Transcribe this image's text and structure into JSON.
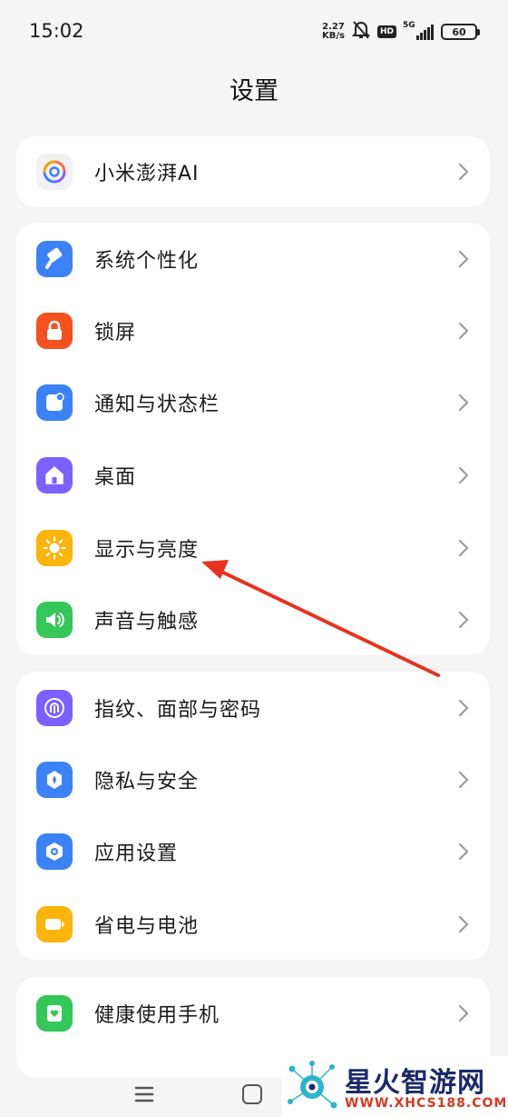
{
  "status_bar": {
    "time": "15:02",
    "net_speed_value": "2.27",
    "net_speed_unit": "KB/s",
    "hd": "HD",
    "network": "5G",
    "battery": "60"
  },
  "page": {
    "title": "设置"
  },
  "groups": [
    {
      "items": [
        {
          "label": "小米澎湃AI",
          "icon": "xiaomi-hyperai-icon"
        }
      ]
    },
    {
      "items": [
        {
          "label": "系统个性化",
          "icon": "brush-icon",
          "color": "#3b82f6"
        },
        {
          "label": "锁屏",
          "icon": "lock-icon",
          "color": "#f4511e"
        },
        {
          "label": "通知与状态栏",
          "icon": "notification-icon",
          "color": "#3b82f6"
        },
        {
          "label": "桌面",
          "icon": "home-icon",
          "color": "#7b61ff"
        },
        {
          "label": "显示与亮度",
          "icon": "sun-icon",
          "color": "#fbb40a"
        },
        {
          "label": "声音与触感",
          "icon": "speaker-icon",
          "color": "#34c759"
        }
      ]
    },
    {
      "items": [
        {
          "label": "指纹、面部与密码",
          "icon": "fingerprint-icon",
          "color": "#7b61ff"
        },
        {
          "label": "隐私与安全",
          "icon": "shield-icon",
          "color": "#3b82f6"
        },
        {
          "label": "应用设置",
          "icon": "app-settings-icon",
          "color": "#3b82f6"
        },
        {
          "label": "省电与电池",
          "icon": "battery-icon",
          "color": "#fbb40a"
        }
      ]
    },
    {
      "items": [
        {
          "label": "健康使用手机",
          "icon": "health-icon",
          "color": "#34c759"
        }
      ]
    }
  ],
  "annotation": {
    "type": "red-arrow",
    "target": "显示与亮度",
    "color": "#e8321e"
  },
  "navigation": {
    "menu_icon": "menu-icon",
    "home_icon": "home-square-icon"
  },
  "watermark": {
    "title": "星火智游网",
    "url": "WWW.XHCS188.COM"
  }
}
